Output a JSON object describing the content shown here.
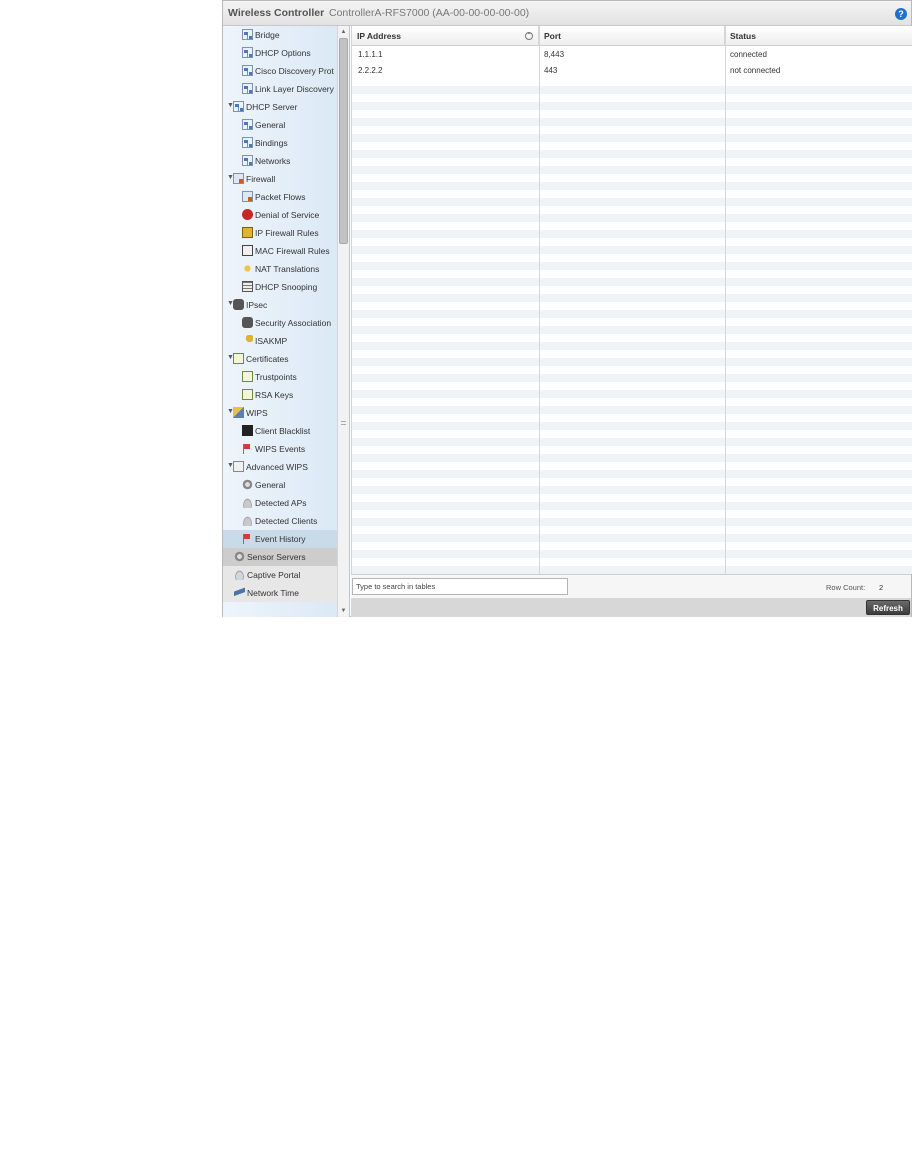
{
  "header": {
    "app_title": "Wireless Controller",
    "device_title": "ControllerA-RFS7000 (AA-00-00-00-00-00)",
    "help_icon": "?"
  },
  "sidebar": {
    "items": [
      {
        "label": "Bridge",
        "icon": "network-icon",
        "level": 2
      },
      {
        "label": "DHCP Options",
        "icon": "network-icon",
        "level": 2
      },
      {
        "label": "Cisco Discovery Prot",
        "icon": "network-icon",
        "level": 2
      },
      {
        "label": "Link Layer Discovery",
        "icon": "network-icon",
        "level": 2
      },
      {
        "label": "DHCP Server",
        "icon": "network-icon",
        "level": 1,
        "expanded": true
      },
      {
        "label": "General",
        "icon": "network-icon",
        "level": 2
      },
      {
        "label": "Bindings",
        "icon": "network-icon",
        "level": 2
      },
      {
        "label": "Networks",
        "icon": "network-icon",
        "level": 2
      },
      {
        "label": "Firewall",
        "icon": "firewall-icon",
        "level": 1,
        "expanded": true
      },
      {
        "label": "Packet Flows",
        "icon": "firewall-icon",
        "level": 2
      },
      {
        "label": "Denial of Service",
        "icon": "denial-of-service-icon",
        "level": 2
      },
      {
        "label": "IP Firewall Rules",
        "icon": "ip-firewall-icon",
        "level": 2
      },
      {
        "label": "MAC Firewall Rules",
        "icon": "mac-firewall-icon",
        "level": 2
      },
      {
        "label": "NAT Translations",
        "icon": "nat-icon",
        "level": 2
      },
      {
        "label": "DHCP Snooping",
        "icon": "dhcp-snooping-icon",
        "level": 2
      },
      {
        "label": "IPsec",
        "icon": "lock-icon",
        "level": 1,
        "expanded": true
      },
      {
        "label": "Security Association",
        "icon": "lock-icon",
        "level": 2
      },
      {
        "label": "ISAKMP",
        "icon": "key-icon",
        "level": 2
      },
      {
        "label": "Certificates",
        "icon": "certificate-icon",
        "level": 1,
        "expanded": true
      },
      {
        "label": "Trustpoints",
        "icon": "certificate-icon",
        "level": 2
      },
      {
        "label": "RSA Keys",
        "icon": "certificate-icon",
        "level": 2
      },
      {
        "label": "WIPS",
        "icon": "wips-icon",
        "level": 1,
        "expanded": true
      },
      {
        "label": "Client Blacklist",
        "icon": "blacklist-icon",
        "level": 2
      },
      {
        "label": "WIPS Events",
        "icon": "flag-icon",
        "level": 2
      },
      {
        "label": "Advanced WIPS",
        "icon": "document-icon",
        "level": 1,
        "expanded": true
      },
      {
        "label": "General",
        "icon": "gear-icon",
        "level": 2
      },
      {
        "label": "Detected APs",
        "icon": "access-point-icon",
        "level": 2
      },
      {
        "label": "Detected Clients",
        "icon": "access-point-icon",
        "level": 2
      },
      {
        "label": "Event History",
        "icon": "flag-icon",
        "level": 2,
        "selected": true
      },
      {
        "label": "Sensor Servers",
        "icon": "gear-icon",
        "level": 0,
        "active": true
      },
      {
        "label": "Captive Portal",
        "icon": "captive-portal-icon",
        "level": 0
      },
      {
        "label": "Network Time",
        "icon": "network-time-icon",
        "level": 0
      }
    ]
  },
  "table": {
    "columns": [
      "IP Address",
      "Port",
      "Status"
    ],
    "rows": [
      {
        "ip": "1.1.1.1",
        "port": "8,443",
        "status": "connected"
      },
      {
        "ip": "2.2.2.2",
        "port": "443",
        "status": "not connected"
      }
    ]
  },
  "footer": {
    "search_placeholder": "Type to search in tables",
    "row_count_label": "Row Count:",
    "row_count_value": "2",
    "refresh_label": "Refresh"
  },
  "colors": {
    "accent": "#1f6fd1",
    "selected_row": "#c9dbe9",
    "sidebar_bg": "#d9e8f5"
  }
}
